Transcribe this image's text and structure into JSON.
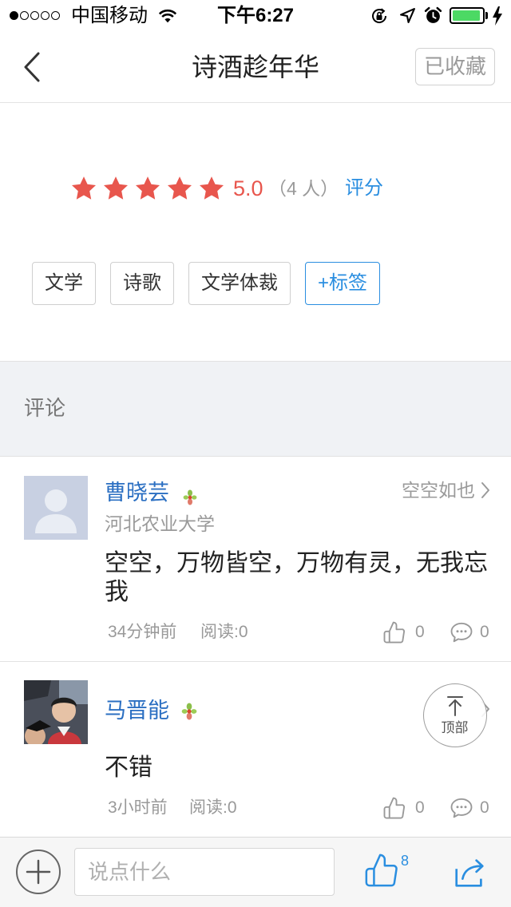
{
  "status_bar": {
    "signal": {
      "level": 1,
      "max": 5
    },
    "carrier": "中国移动",
    "time": "下午6:27",
    "battery_level": 0.95,
    "icons": [
      "wifi-icon",
      "rotation-lock-icon",
      "location-arrow-icon",
      "alarm-icon",
      "battery-icon",
      "charging-bolt-icon"
    ]
  },
  "nav": {
    "back_icon": "chevron-left-icon",
    "title": "诗酒趁年华",
    "collect_label": "已收藏"
  },
  "rating": {
    "score": "5.0",
    "stars_filled": 5,
    "stars_total": 5,
    "count": "（4 人）",
    "rate_label": "评分"
  },
  "tags": {
    "items": [
      "文学",
      "诗歌",
      "文学体裁"
    ],
    "add_label": "+标签"
  },
  "comments_section": {
    "label": "评论"
  },
  "comments": [
    {
      "name": "曹晓芸",
      "school": "河北农业大学",
      "signature": "空空如也",
      "content": "空空，万物皆空，万物有灵，无我忘我",
      "time": "34分钟前",
      "reads": "阅读:0",
      "likes": "0",
      "replies": "0"
    },
    {
      "name": "马晋能",
      "content": "不错",
      "time": "3小时前",
      "reads": "阅读:0",
      "likes": "0",
      "replies": "0"
    }
  ],
  "back_to_top": {
    "label": "顶部"
  },
  "composer": {
    "placeholder": "说点什么",
    "like_count": "8",
    "icons": [
      "plus-circle-icon",
      "thumbs-up-icon",
      "share-icon"
    ]
  },
  "colors": {
    "accent": "#2a8ee0",
    "star": "#e8564d",
    "name": "#2b6fc2",
    "battery": "#4cd964"
  }
}
